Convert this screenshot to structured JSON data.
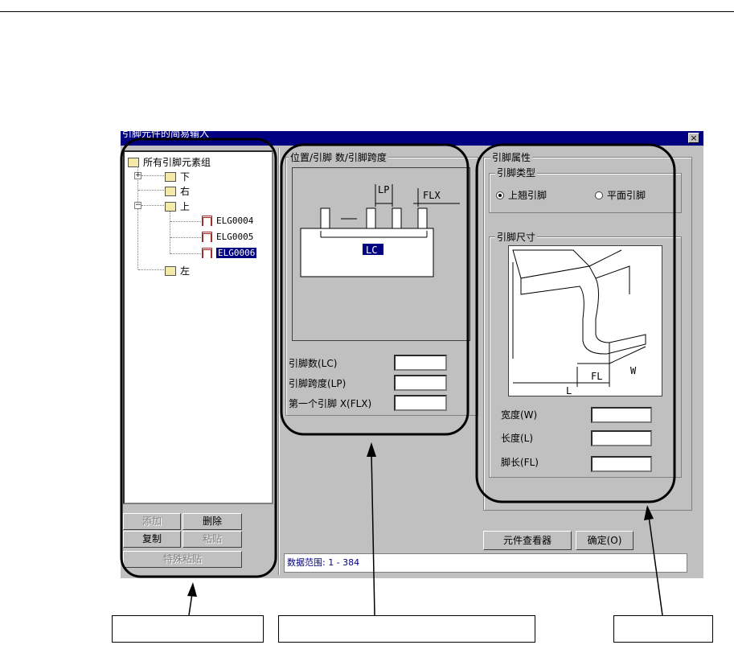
{
  "window": {
    "title": "引脚元件的简易输入"
  },
  "tree": {
    "root": "所有引脚元素组",
    "items": [
      "下",
      "右",
      "上",
      "左"
    ],
    "children_of_up": [
      "ELG0004",
      "ELG0005",
      "ELG0006"
    ],
    "selected": "ELG0006"
  },
  "buttons": {
    "add": "添加",
    "delete": "删除",
    "copy": "复制",
    "paste": "粘贴",
    "special_paste": "特殊粘贴",
    "viewer": "元件查看器",
    "ok": "确定(O)"
  },
  "position_group": {
    "title": "位置/引脚 数/引脚跨度",
    "diagram_labels": {
      "lp": "LP",
      "flx": "FLX",
      "lc": "LC"
    },
    "fields": [
      {
        "label": "引脚数(LC)",
        "value": ""
      },
      {
        "label": "引脚跨度(LP)",
        "value": ""
      },
      {
        "label": "第一个引脚 X(FLX)",
        "value": ""
      }
    ]
  },
  "attributes_group": {
    "title": "引脚属性",
    "type_title": "引脚类型",
    "type_options": [
      "上翘引脚",
      "平面引脚"
    ],
    "type_selected": "上翘引脚",
    "size_title": "引脚尺寸",
    "diagram_labels": {
      "fl": "FL",
      "w": "W",
      "l": "L"
    },
    "fields": [
      {
        "label": "宽度(W)",
        "value": ""
      },
      {
        "label": "长度(L)",
        "value": ""
      },
      {
        "label": "脚长(FL)",
        "value": ""
      }
    ]
  },
  "status": {
    "text": "数据范围:  1 - 384"
  },
  "colors": {
    "title_bar": "#000080",
    "window_bg": "#c0c0c0",
    "chip_red": "#a0302a"
  }
}
